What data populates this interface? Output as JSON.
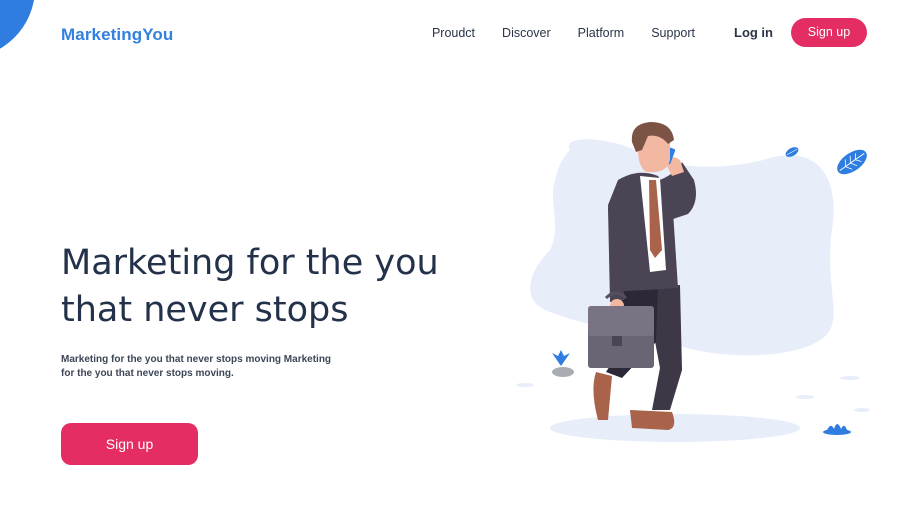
{
  "brand": {
    "name": "MarketingYou",
    "accent": "#3380e0",
    "cta_color": "#e42d63"
  },
  "nav": {
    "links": [
      "Proudct",
      "Discover",
      "Platform",
      "Support"
    ],
    "login": "Log in",
    "signup": "Sign up"
  },
  "hero": {
    "title_line1": "Marketing for the you",
    "title_line2": "that never stops",
    "subtitle": "Marketing for the you that never stops moving Marketing for the you that never stops moving.",
    "cta": "Sign up"
  },
  "illustration": {
    "subject": "businessman-walking-with-phone-and-briefcase"
  }
}
